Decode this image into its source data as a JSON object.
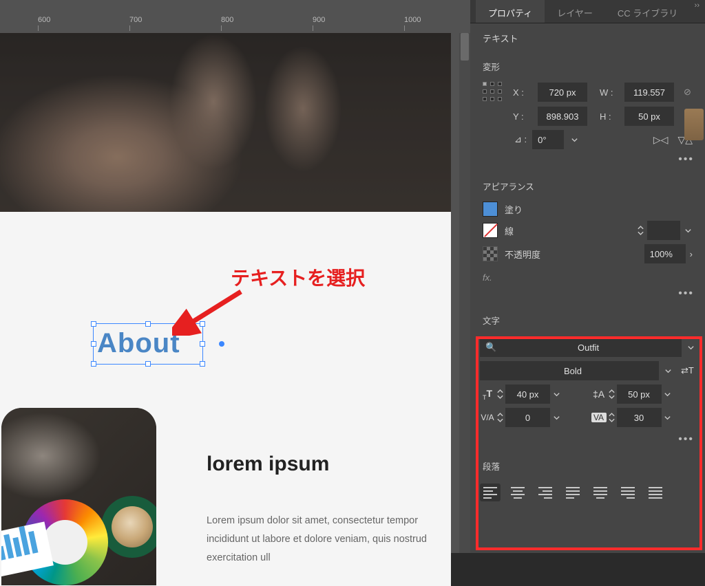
{
  "ruler": {
    "t600": "600",
    "t700": "700",
    "t800": "800",
    "t900": "900",
    "t1000": "1000"
  },
  "canvas": {
    "selected_text": "About",
    "annotation": "テキストを選択",
    "lorem_heading": "lorem ipsum",
    "lorem_body": "Lorem ipsum dolor sit amet, consectetur tempor incididunt ut labore et dolore veniam, quis nostrud exercitation ull"
  },
  "panel": {
    "tabs": {
      "properties": "プロパティ",
      "layers": "レイヤー",
      "cc_lib": "CC ライブラリ"
    },
    "group_text": "テキスト",
    "transform": {
      "title": "変形",
      "x_label": "X :",
      "x": "720 px",
      "y_label": "Y :",
      "y": "898.903",
      "w_label": "W :",
      "w": "119.557",
      "h_label": "H :",
      "h": "50 px",
      "angle_icon": "⊿ :",
      "angle": "0°"
    },
    "appearance": {
      "title": "アピアランス",
      "fill_label": "塗り",
      "stroke_label": "線",
      "opacity_label": "不透明度",
      "opacity_value": "100%"
    },
    "fx": "fx.",
    "character": {
      "title": "文字",
      "font": "Outfit",
      "weight": "Bold",
      "size": "40 px",
      "leading": "50 px",
      "kerning": "0",
      "tracking": "30"
    },
    "paragraph": {
      "title": "段落"
    }
  }
}
